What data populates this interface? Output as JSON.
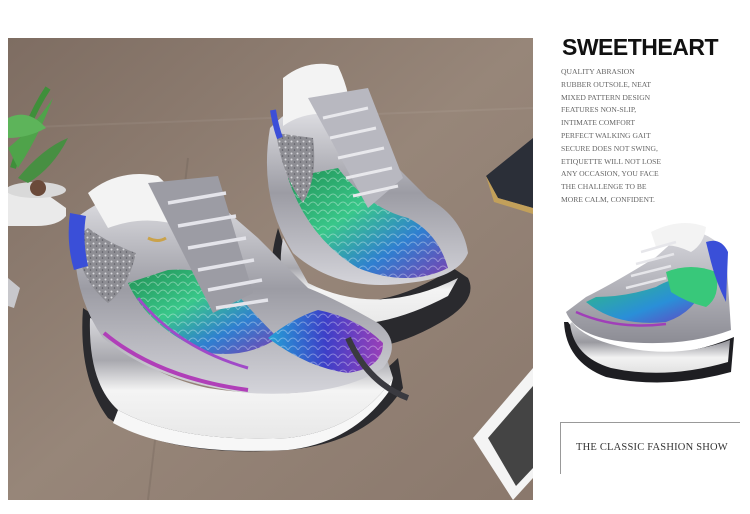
{
  "product": {
    "title": "SWEETHEART",
    "description_lines": [
      "QUALITY ABRASION",
      "RUBBER OUTSOLE, NEAT",
      "MIXED PATTERN DESIGN",
      "FEATURES NON-SLIP,",
      "INTIMATE COMFORT",
      "PERFECT WALKING GAIT",
      "SECURE DOES NOT SWING,",
      "ETIQUETTE WILL NOT LOSE",
      "ANY OCCASION, YOU FACE",
      "THE CHALLENGE TO BE",
      "MORE CALM, CONFIDENT."
    ],
    "caption": "THE CLASSIC FASHION SHOW"
  },
  "colors": {
    "floor": "#8f7d70",
    "sequin_green": "#2fb08a",
    "sequin_blue": "#3a5fd0",
    "metallic_silver": "#b8b8c0",
    "sole_white": "#f2f2f2"
  }
}
